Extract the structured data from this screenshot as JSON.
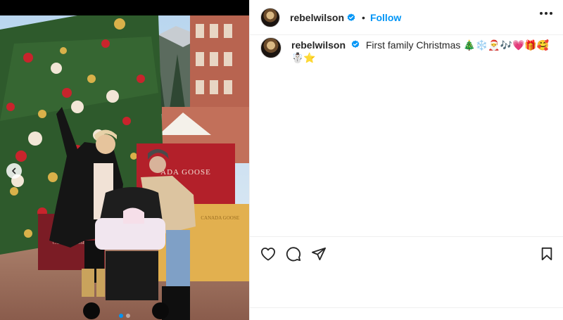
{
  "post": {
    "username": "rebelwilson",
    "follow_label": "Follow",
    "separator": "•",
    "caption_username": "rebelwilson",
    "caption_text": "First family Christmas 🎄❄️🎅🎶💗🎁🥰☃️⭐"
  },
  "media": {
    "carousel_count": 2,
    "active_index": 0,
    "store_sign_1": "ADA GOOSE",
    "store_sign_2": "CANADA GOOSE",
    "store_sign_3": "CANADA GOOSE"
  },
  "icons": {
    "verified": "verified-badge-icon",
    "more": "more-options-icon",
    "like": "heart-icon",
    "comment": "comment-icon",
    "share": "share-icon",
    "save": "bookmark-icon",
    "prev": "chevron-left-icon"
  },
  "colors": {
    "accent": "#0095f6",
    "text": "#262626",
    "border": "#efefef"
  }
}
